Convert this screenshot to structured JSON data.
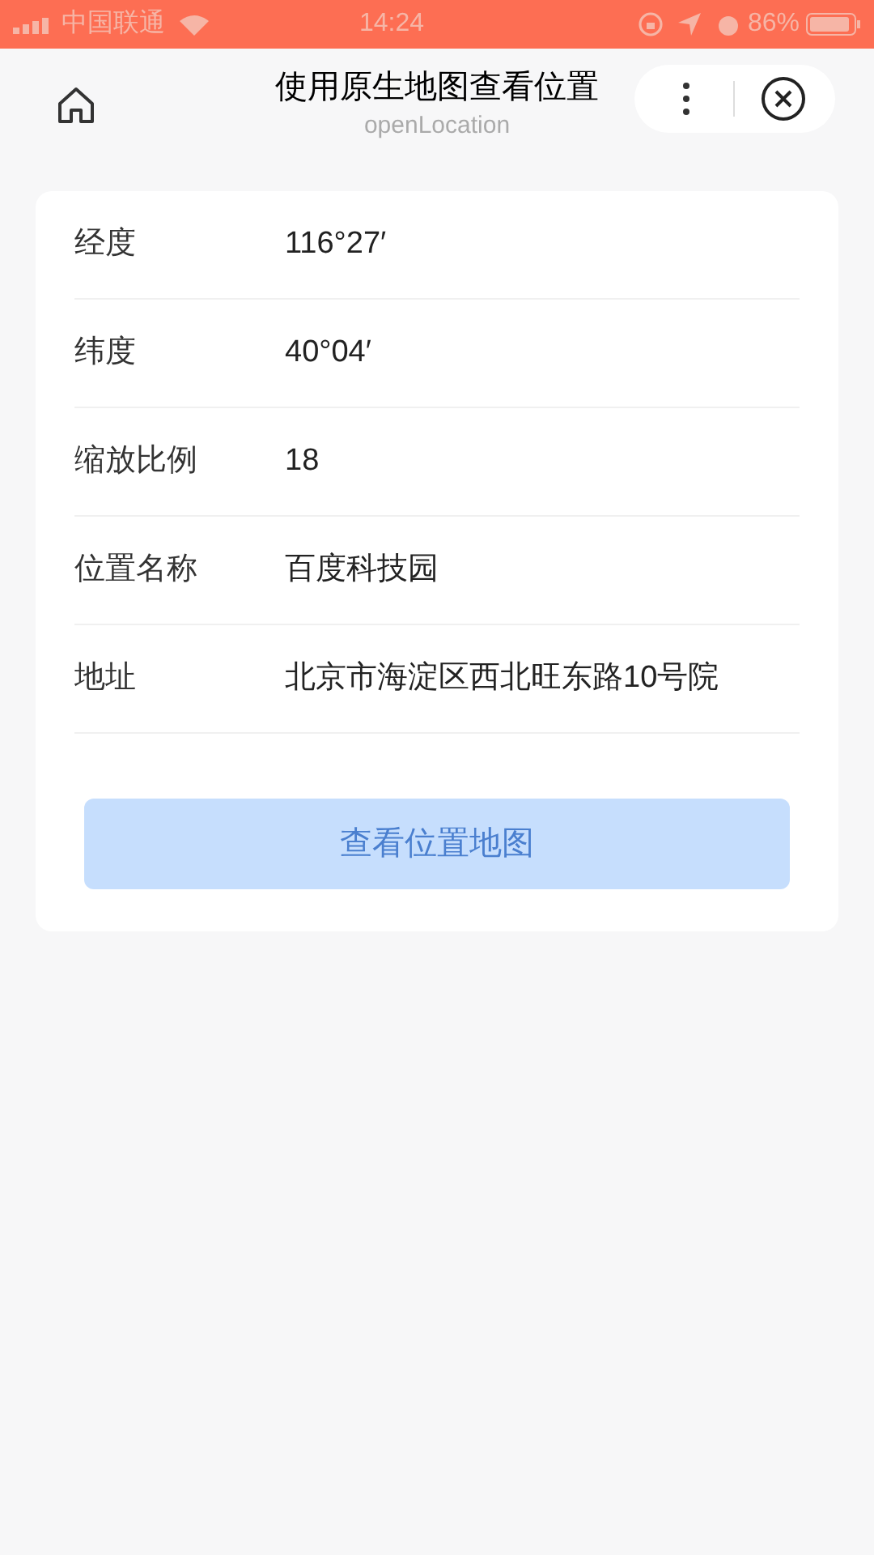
{
  "status_bar": {
    "carrier": "中国联通",
    "time": "14:24",
    "battery": "86%"
  },
  "nav": {
    "title": "使用原生地图查看位置",
    "subtitle": "openLocation"
  },
  "fields": [
    {
      "label": "经度",
      "value": "116°27′"
    },
    {
      "label": "纬度",
      "value": "40°04′"
    },
    {
      "label": "缩放比例",
      "value": "18"
    },
    {
      "label": "位置名称",
      "value": "百度科技园"
    },
    {
      "label": "地址",
      "value": "北京市海淀区西北旺东路10号院"
    }
  ],
  "button": {
    "label": "查看位置地图",
    "disabled": true
  }
}
